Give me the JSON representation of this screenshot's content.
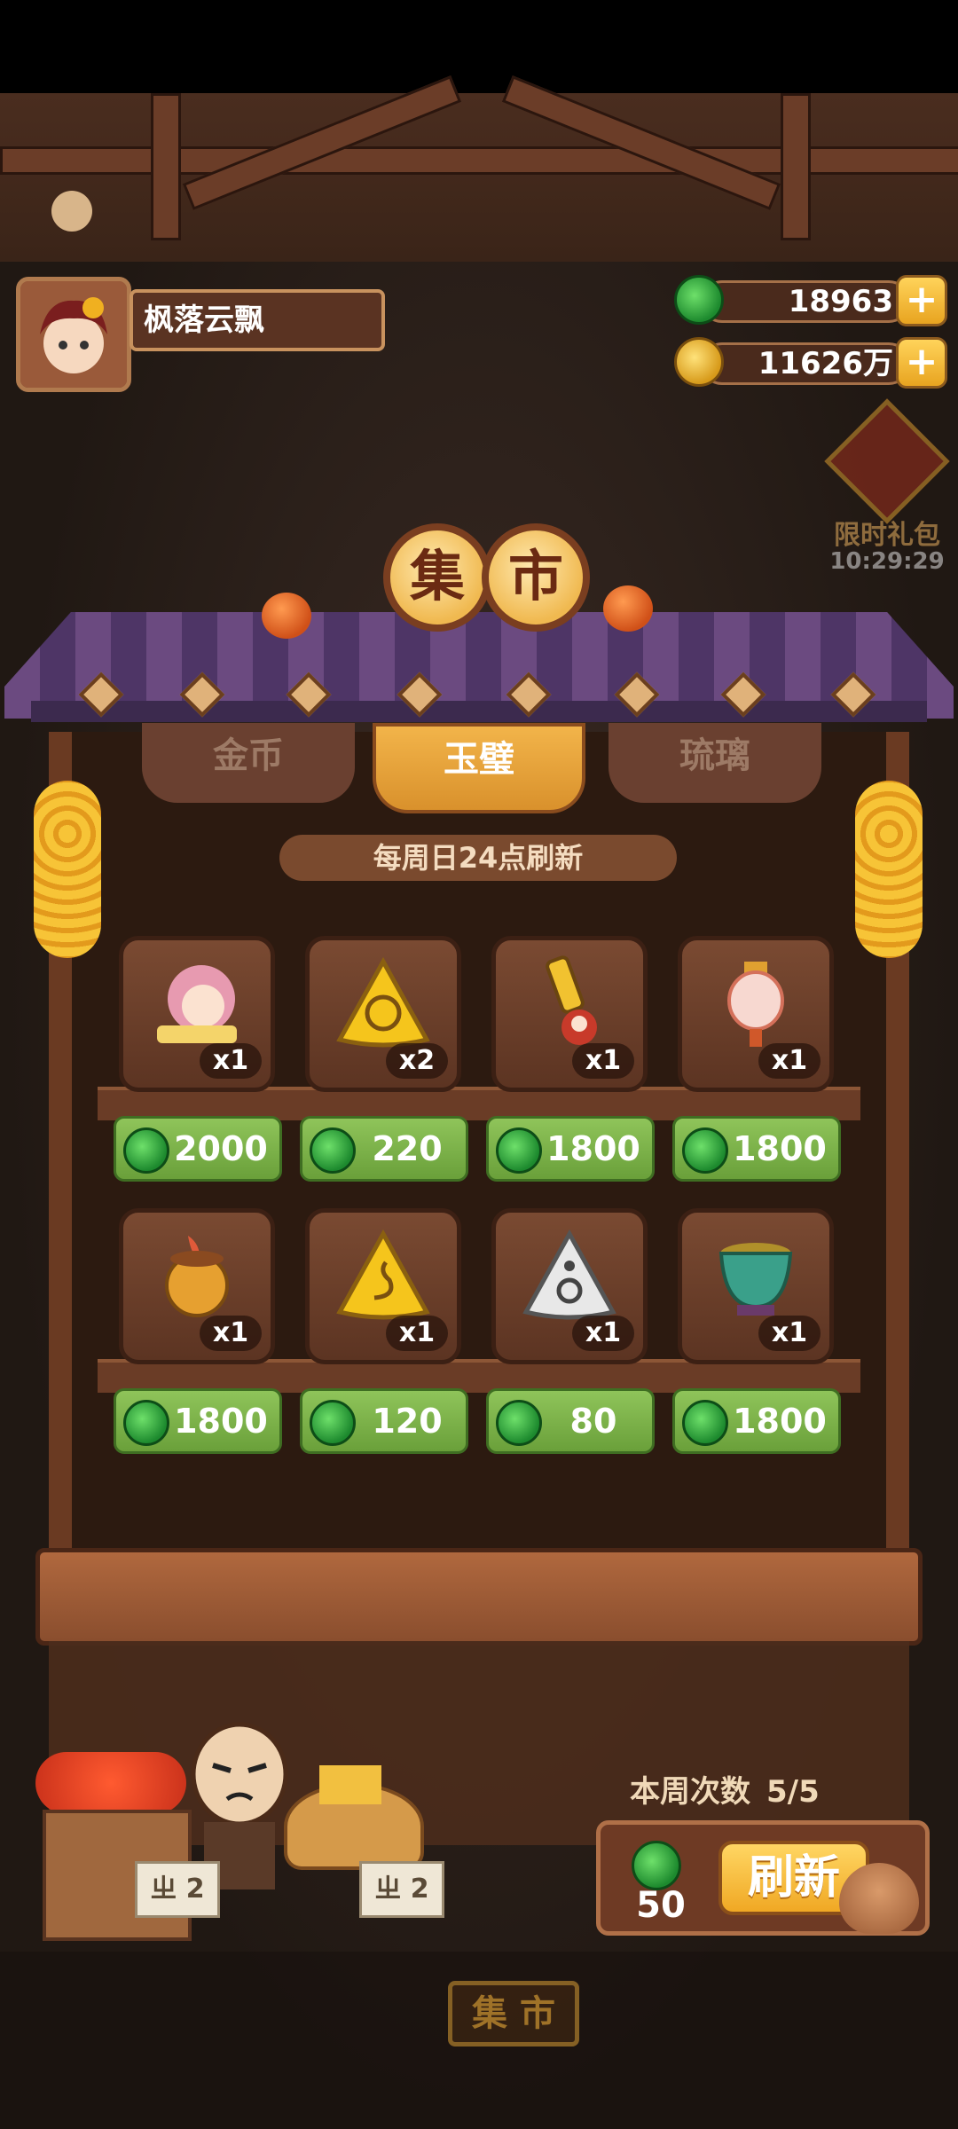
{
  "player": {
    "name": "枫落云飘"
  },
  "currency": {
    "jade": {
      "amount": "18963",
      "icon": "jade-coin-icon"
    },
    "gold": {
      "amount": "11626万",
      "icon": "copper-coin-icon"
    },
    "add_label": "+"
  },
  "limited_pack": {
    "label": "限时礼包",
    "timer": "10:29:29"
  },
  "market": {
    "title_chars": [
      "集",
      "市"
    ],
    "tabs": [
      {
        "label": "金币",
        "active": false
      },
      {
        "label": "玉璧",
        "active": true
      },
      {
        "label": "琉璃",
        "active": false
      }
    ],
    "refresh_note": "每周日24点刷新",
    "items": [
      {
        "art": "girl-sleeping-icon",
        "qty": "x1",
        "price": "2000"
      },
      {
        "art": "gold-triangle-talisman-icon",
        "qty": "x2",
        "price": "220"
      },
      {
        "art": "golden-sword-doll-icon",
        "qty": "x1",
        "price": "1800"
      },
      {
        "art": "lantern-icon",
        "qty": "x1",
        "price": "1800"
      },
      {
        "art": "flower-pot-icon",
        "qty": "x1",
        "price": "1800"
      },
      {
        "art": "gold-triangle-swirl-icon",
        "qty": "x1",
        "price": "120"
      },
      {
        "art": "silver-triangle-icon",
        "qty": "x1",
        "price": "80"
      },
      {
        "art": "jade-cauldron-icon",
        "qty": "x1",
        "price": "1800"
      }
    ]
  },
  "weekly": {
    "label": "本周次数",
    "value": "5/5"
  },
  "refresh": {
    "cost": "50",
    "button_label": "刷新"
  },
  "stall_signs": [
    "ㄓ 2",
    "ㄓ 2"
  ],
  "bottom_sign": "集 市",
  "colors": {
    "price_green": "#7db34a",
    "tab_active": "#e8a233",
    "wood": "#6a3a22"
  }
}
